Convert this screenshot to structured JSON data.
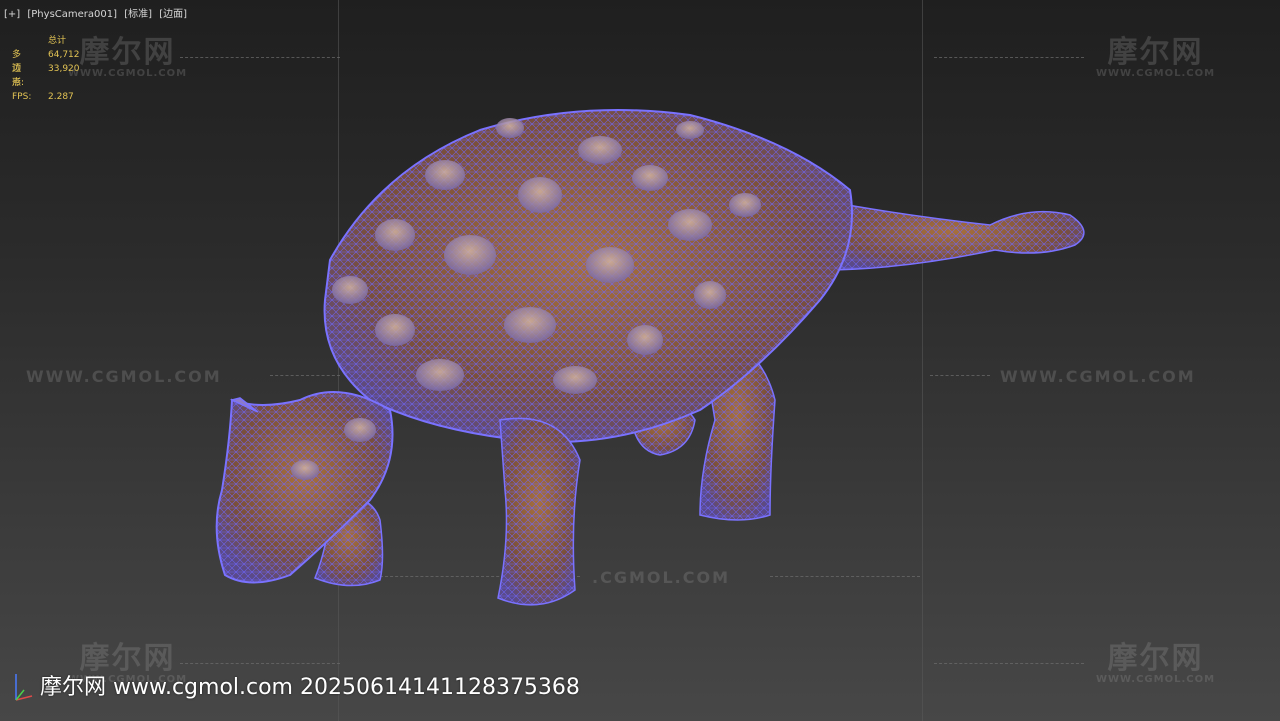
{
  "viewport": {
    "labels": [
      "[+]",
      "[PhysCamera001]",
      "[标准]",
      "[边面]"
    ]
  },
  "stats": {
    "header": "总计",
    "polygons_label": "多边形:",
    "polygons_value": "64,712",
    "vertices_label": "顶点:",
    "vertices_value": "33,920",
    "fps_label": "FPS:",
    "fps_value": "2.287"
  },
  "watermark": {
    "logo_text": "摩尔网",
    "logo_sub": "WWW.CGMOL.COM",
    "url_text": "WWW.CGMOL.COM",
    "url_partial": ".CGMOL.COM",
    "footer": "摩尔网 www.cgmol.com 20250614141128375368"
  },
  "colors": {
    "wire": "#6a62ff",
    "skin": "#a06a3c",
    "stats_text": "#e3c454"
  },
  "icons": {
    "axis": "axis-gizmo-icon"
  }
}
